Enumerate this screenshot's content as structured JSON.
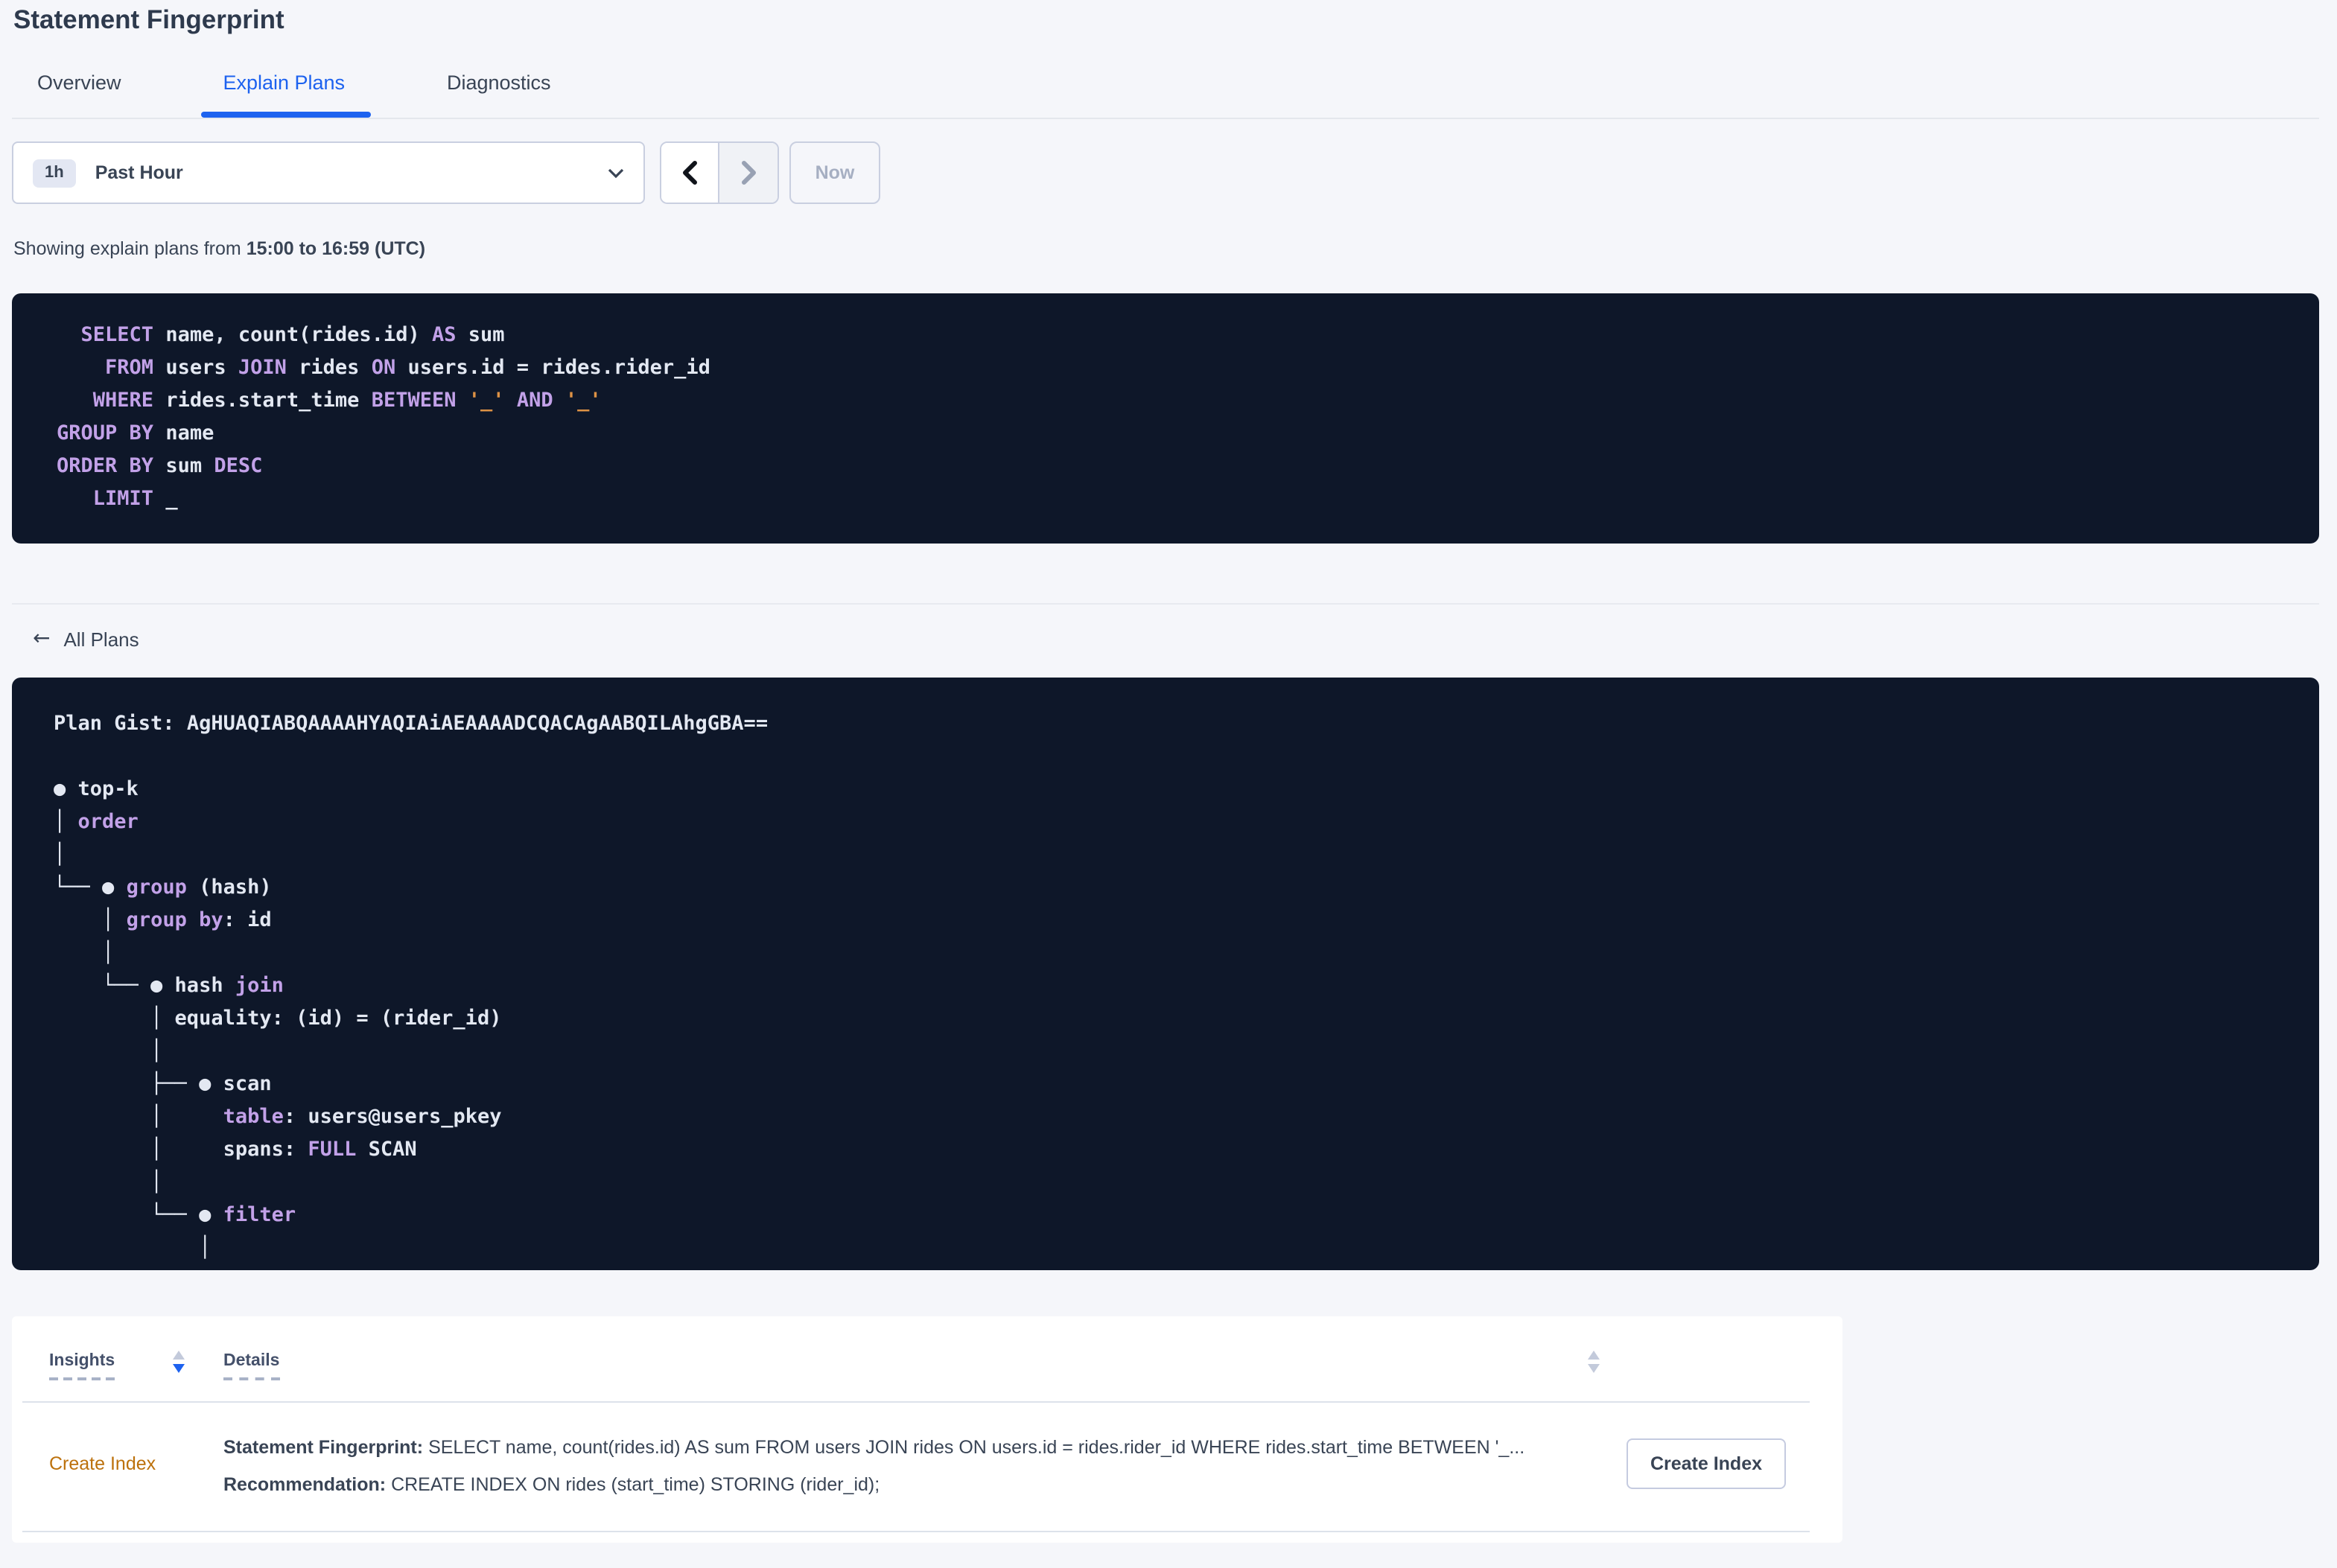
{
  "colors": {
    "accent_blue": "#1D62EF",
    "keyword_purple": "#C2A1E8",
    "string_orange": "#DD9245",
    "code_background": "#0E1729",
    "insight_link_orange": "#BC710C",
    "text_dark": "#394455"
  },
  "page": {
    "title": "Statement Fingerprint"
  },
  "tabs": [
    {
      "label": "Overview"
    },
    {
      "label": "Explain Plans"
    },
    {
      "label": "Diagnostics"
    }
  ],
  "toolbar": {
    "time_badge": "1h",
    "time_label": "Past Hour",
    "now_label": "Now"
  },
  "showing": {
    "prefix": "Showing explain plans from ",
    "range": "15:00 to 16:59 (UTC)"
  },
  "sql": {
    "lines": [
      [
        [
          "p",
          "  "
        ],
        [
          "k",
          "SELECT"
        ],
        [
          "p",
          " name, count(rides.id) "
        ],
        [
          "k",
          "AS"
        ],
        [
          "p",
          " sum"
        ]
      ],
      [
        [
          "p",
          "    "
        ],
        [
          "k",
          "FROM"
        ],
        [
          "p",
          " users "
        ],
        [
          "k",
          "JOIN"
        ],
        [
          "p",
          " rides "
        ],
        [
          "k",
          "ON"
        ],
        [
          "p",
          " users.id = rides.rider_id"
        ]
      ],
      [
        [
          "p",
          "   "
        ],
        [
          "k",
          "WHERE"
        ],
        [
          "p",
          " rides.start_time "
        ],
        [
          "k",
          "BETWEEN"
        ],
        [
          "p",
          " "
        ],
        [
          "s",
          "'_'"
        ],
        [
          "p",
          " "
        ],
        [
          "k",
          "AND"
        ],
        [
          "p",
          " "
        ],
        [
          "s",
          "'_'"
        ]
      ],
      [
        [
          "k",
          "GROUP BY"
        ],
        [
          "p",
          " name"
        ]
      ],
      [
        [
          "k",
          "ORDER BY"
        ],
        [
          "p",
          " sum "
        ],
        [
          "k",
          "DESC"
        ]
      ],
      [
        [
          "p",
          "   "
        ],
        [
          "k",
          "LIMIT"
        ],
        [
          "p",
          " _"
        ]
      ]
    ]
  },
  "all_plans": {
    "label": "All Plans"
  },
  "plan": {
    "gist_label": "Plan Gist: ",
    "gist": "AgHUAQIABQAAAAHYAQIAiAEAAAADCQACAgAABQILAhgGBA==",
    "tree": [
      [
        [
          "p",
          "● top-k"
        ]
      ],
      [
        [
          "p",
          "│ "
        ],
        [
          "k",
          "order"
        ]
      ],
      [
        [
          "p",
          "│"
        ]
      ],
      [
        [
          "p",
          "└── ● "
        ],
        [
          "k",
          "group"
        ],
        [
          "p",
          " (hash)"
        ]
      ],
      [
        [
          "p",
          "    │ "
        ],
        [
          "k",
          "group by"
        ],
        [
          "p",
          ": id"
        ]
      ],
      [
        [
          "p",
          "    │"
        ]
      ],
      [
        [
          "p",
          "    └── ● hash "
        ],
        [
          "k",
          "join"
        ]
      ],
      [
        [
          "p",
          "        │ equality: (id) = (rider_id)"
        ]
      ],
      [
        [
          "p",
          "        │"
        ]
      ],
      [
        [
          "p",
          "        ├── ● scan"
        ]
      ],
      [
        [
          "p",
          "        │     "
        ],
        [
          "k",
          "table"
        ],
        [
          "p",
          ": users@users_pkey"
        ]
      ],
      [
        [
          "p",
          "        │     spans: "
        ],
        [
          "k",
          "FULL"
        ],
        [
          "p",
          " SCAN"
        ]
      ],
      [
        [
          "p",
          "        │"
        ]
      ],
      [
        [
          "p",
          "        └── ● "
        ],
        [
          "k",
          "filter"
        ]
      ],
      [
        [
          "p",
          "            │"
        ]
      ]
    ]
  },
  "insights": {
    "columns": [
      {
        "label": "Insights"
      },
      {
        "label": "Details"
      }
    ],
    "row": {
      "insight_link": "Create Index",
      "fingerprint_label": "Statement Fingerprint:",
      "fingerprint_text": "SELECT name, count(rides.id) AS sum FROM users JOIN rides ON users.id = rides.rider_id WHERE rides.start_time BETWEEN '_...",
      "recommendation_label": "Recommendation:",
      "recommendation_text": "CREATE INDEX ON rides (start_time) STORING (rider_id);",
      "action_label": "Create Index"
    }
  }
}
